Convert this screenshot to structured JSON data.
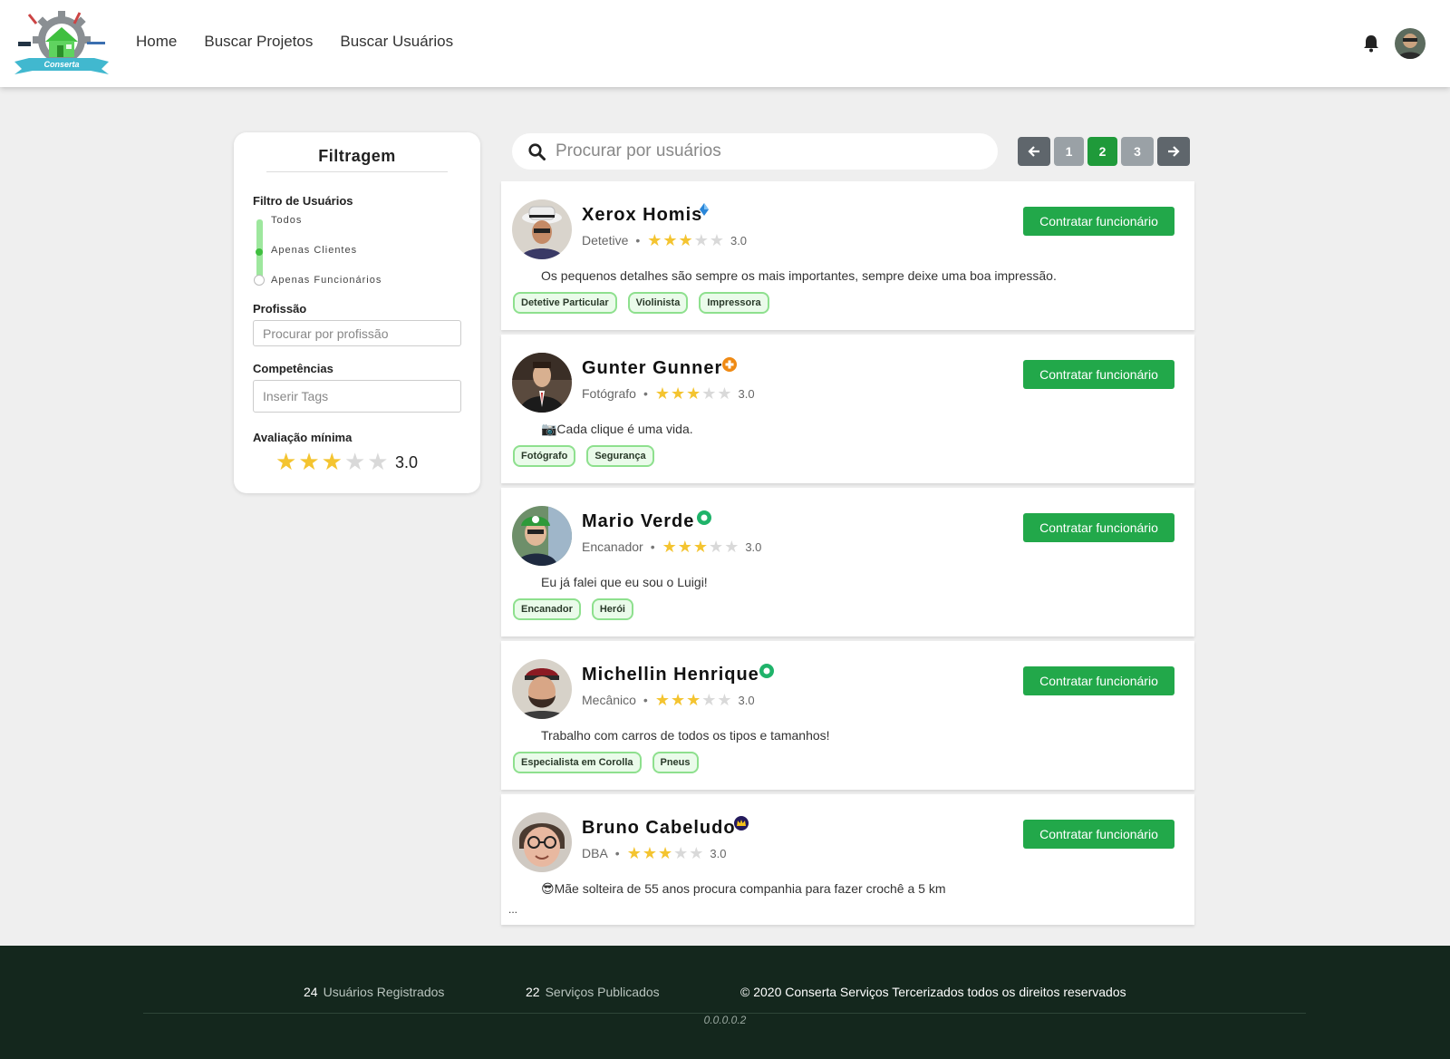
{
  "nav": {
    "logo_text": "Conserta",
    "links": [
      "Home",
      "Buscar Projetos",
      "Buscar Usuários"
    ]
  },
  "filter": {
    "title": "Filtragem",
    "user_filter_label": "Filtro de Usuários",
    "user_filter_options": [
      "Todos",
      "Apenas Clientes",
      "Apenas Funcionários"
    ],
    "user_filter_selected": "Apenas Clientes",
    "profession_label": "Profissão",
    "profession_placeholder": "Procurar por profissão",
    "skills_label": "Competências",
    "skills_placeholder": "Inserir Tags",
    "min_rating_label": "Avaliação mínima",
    "min_rating_value": "3.0",
    "min_rating_stars": 3
  },
  "search": {
    "placeholder": "Procurar por usuários"
  },
  "pagination": {
    "pages": [
      "1",
      "2",
      "3"
    ],
    "current": "2"
  },
  "users": [
    {
      "name": "Xerox Homis",
      "badge_icon": "blue-diamond-icon",
      "profession": "Detetive",
      "rating": "3.0",
      "stars": 3,
      "description": "Os pequenos detalhes são sempre os mais importantes, sempre deixe uma boa impressão.",
      "tags": [
        "Detetive Particular",
        "Violinista",
        "Impressora"
      ],
      "hire_label": "Contratar funcionário"
    },
    {
      "name": "Gunter Gunner",
      "badge_icon": "orange-plus-icon",
      "profession": "Fotógrafo",
      "rating": "3.0",
      "stars": 3,
      "description": "📷Cada clique é uma vida.",
      "tags": [
        "Fotógrafo",
        "Segurança"
      ],
      "hire_label": "Contratar funcionário"
    },
    {
      "name": "Mario Verde",
      "badge_icon": "green-ring-icon",
      "profession": "Encanador",
      "rating": "3.0",
      "stars": 3,
      "description": "Eu já falei que eu sou o Luigi!",
      "tags": [
        "Encanador",
        "Herói"
      ],
      "hire_label": "Contratar funcionário"
    },
    {
      "name": "Michellin Henrique",
      "badge_icon": "green-ring-icon",
      "profession": "Mecânico",
      "rating": "3.0",
      "stars": 3,
      "description": "Trabalho com carros de todos os tipos e tamanhos!",
      "tags": [
        "Especialista em Corolla",
        "Pneus"
      ],
      "hire_label": "Contratar funcionário"
    },
    {
      "name": "Bruno Cabeludo",
      "badge_icon": "crown-icon",
      "profession": "DBA",
      "rating": "3.0",
      "stars": 3,
      "description": "😎Mãe solteira de 55 anos procura companhia para fazer crochê a 5 km",
      "ellipsis": "...",
      "tags": [],
      "hire_label": "Contratar funcionário"
    }
  ],
  "footer": {
    "users_count": "24",
    "users_label": "Usuários Registrados",
    "services_count": "22",
    "services_label": "Serviços Publicados",
    "copyright": "© 2020 Conserta Serviços Tercerizados todos os direitos reservados",
    "version": "0.0.0.0.2"
  },
  "colors": {
    "accent_green": "#22a84a",
    "footer_bg": "#14271d",
    "star": "#f4c430",
    "tag_border": "#8ee08e"
  }
}
